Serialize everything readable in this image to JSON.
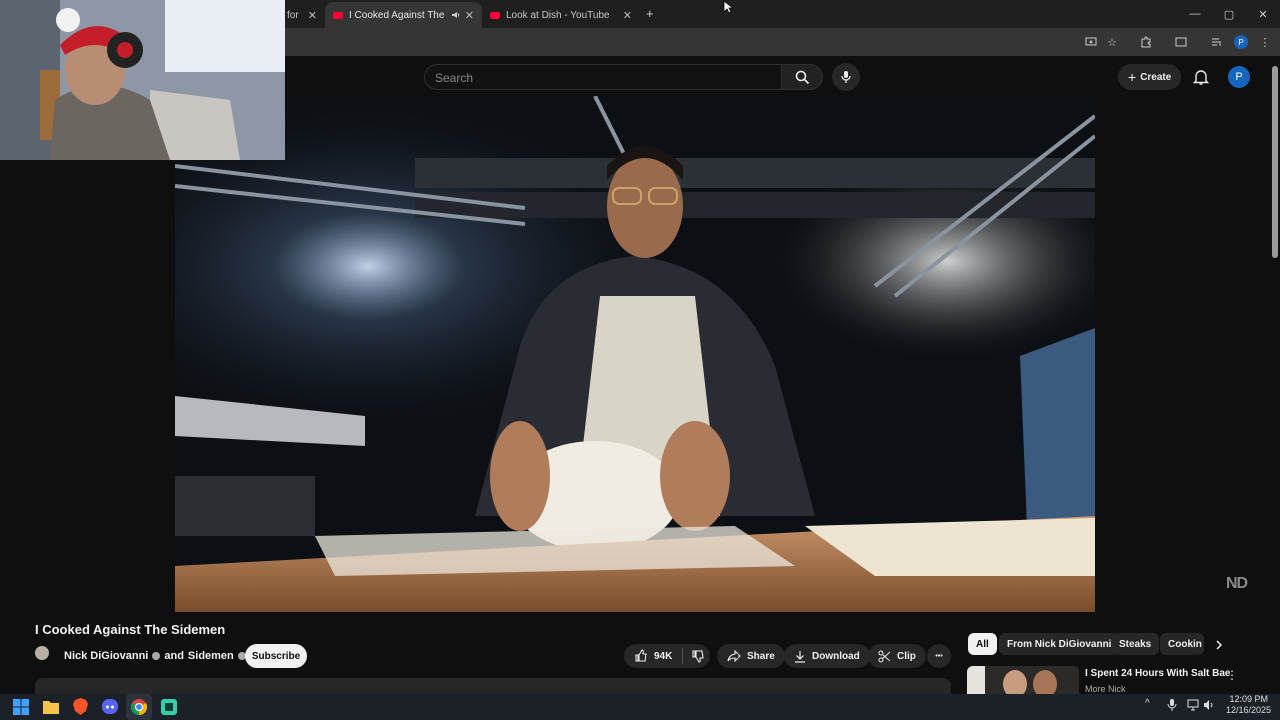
{
  "browser": {
    "tabs": [
      {
        "label": "for",
        "close": "✕"
      },
      {
        "label": "I Cooked Against The Sidem",
        "close": "✕"
      },
      {
        "label": "Look at Dish - YouTube",
        "close": "✕"
      }
    ],
    "new_tab": "+",
    "window_controls": [
      "—",
      "▢",
      "✕"
    ]
  },
  "youtube": {
    "search_placeholder": "Search",
    "create_label": "Create",
    "avatar_letter": "P",
    "watermark": "ND",
    "video": {
      "title": "I Cooked Against The Sidemen",
      "channel": "Nick DiGiovanni",
      "channel_join": "and",
      "collab": "Sidemen",
      "subscribe_label": "Subscribe",
      "likes": "94K",
      "share_label": "Share",
      "download_label": "Download",
      "clip_label": "Clip",
      "more": "•••"
    },
    "chips": [
      {
        "label": "All"
      },
      {
        "label": "From Nick DiGiovanni"
      },
      {
        "label": "Steaks"
      },
      {
        "label": "Cookin"
      }
    ],
    "sidebar": {
      "title": "I Spent 24 Hours With Salt Bae",
      "channel": "More Nick"
    }
  },
  "taskbar": {
    "time": "12:09 PM",
    "date": "12/16/2025"
  },
  "colors": {
    "youtube_red": "#ff0033",
    "background": "#0f0f0f",
    "avatar_blue": "#1565c0"
  }
}
